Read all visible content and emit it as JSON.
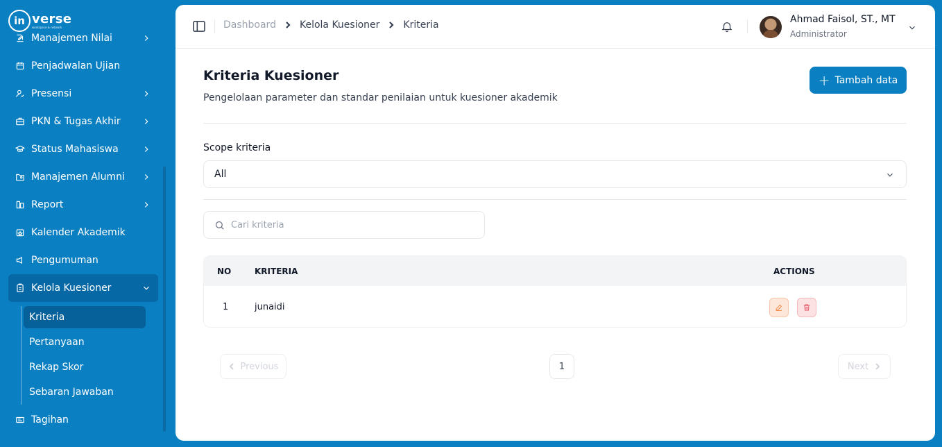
{
  "brand": {
    "logo_mark": "in",
    "logo_word": "verse",
    "logo_sub": "workspace & network"
  },
  "sidebar": {
    "items": [
      {
        "label": "Manajemen Nilai",
        "icon": "edit-square-icon",
        "has_children": true
      },
      {
        "label": "Penjadwalan Ujian",
        "icon": "calendar-icon",
        "has_children": false
      },
      {
        "label": "Presensi",
        "icon": "user-check-icon",
        "has_children": true
      },
      {
        "label": "PKN & Tugas Akhir",
        "icon": "briefcase-icon",
        "has_children": true
      },
      {
        "label": "Status Mahasiswa",
        "icon": "graduation-cap-icon",
        "has_children": true
      },
      {
        "label": "Manajemen Alumni",
        "icon": "folder-user-icon",
        "has_children": true
      },
      {
        "label": "Report",
        "icon": "report-icon",
        "has_children": true
      },
      {
        "label": "Kalender Akademik",
        "icon": "calendar-star-icon",
        "has_children": false
      },
      {
        "label": "Pengumuman",
        "icon": "megaphone-icon",
        "has_children": false
      },
      {
        "label": "Kelola Kuesioner",
        "icon": "clipboard-icon",
        "has_children": true,
        "expanded": true
      }
    ],
    "subitems": [
      {
        "label": "Kriteria",
        "active": true
      },
      {
        "label": "Pertanyaan",
        "active": false
      },
      {
        "label": "Rekap Skor",
        "active": false
      },
      {
        "label": "Sebaran Jawaban",
        "active": false
      }
    ],
    "after": {
      "label": "Tagihan",
      "icon": "receipt-icon"
    }
  },
  "topbar": {
    "breadcrumb": [
      "Dashboard",
      "Kelola Kuesioner",
      "Kriteria"
    ],
    "user_name": "Ahmad Faisol, ST., MT",
    "user_role": "Administrator"
  },
  "page": {
    "title": "Kriteria Kuesioner",
    "subtitle": "Pengelolaan parameter dan standar penilaian untuk kuesioner akademik",
    "add_button": "Tambah data",
    "scope_label": "Scope kriteria",
    "scope_value": "All",
    "search_placeholder": "Cari kriteria"
  },
  "table": {
    "headers": {
      "no": "NO",
      "criteria": "KRITERIA",
      "actions": "ACTIONS"
    },
    "rows": [
      {
        "no": "1",
        "criteria": "junaidi"
      }
    ]
  },
  "pagination": {
    "prev": "Previous",
    "page": "1",
    "next": "Next"
  },
  "colors": {
    "primary": "#0a7fc1",
    "edit": "#f0843c",
    "delete": "#e24a5a"
  }
}
